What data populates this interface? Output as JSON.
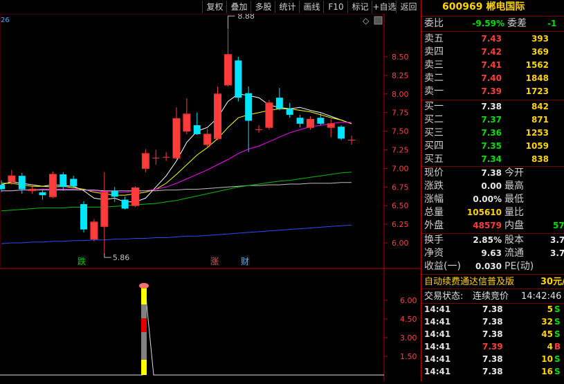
{
  "toolbar": {
    "buttons": [
      "复权",
      "叠加",
      "多股",
      "统计",
      "画线",
      "F10",
      "标记",
      "+自选",
      "返回"
    ]
  },
  "chart": {
    "corner_label": "26",
    "diamond": "◇",
    "price_axis": [
      "8.50",
      "8.25",
      "8.00",
      "7.75",
      "7.50",
      "7.25",
      "7.00",
      "6.75",
      "6.50",
      "6.25",
      "6.00"
    ],
    "high_label": "8.88",
    "low_label": "5.86",
    "markers": [
      {
        "text": "跌",
        "color": "#00c000"
      },
      {
        "text": "涨",
        "color": "#ff3c3c"
      },
      {
        "text": "财",
        "color": "#4fa8ff"
      }
    ],
    "sub_axis": [
      "6.00",
      "4.50",
      "3.00",
      "1.50"
    ]
  },
  "chart_data": {
    "type": "candlestick",
    "ylim": [
      5.75,
      9.0
    ],
    "candles": [
      {
        "o": 6.78,
        "c": 6.72,
        "h": 6.84,
        "l": 6.68
      },
      {
        "o": 6.82,
        "c": 6.9,
        "h": 6.98,
        "l": 6.78
      },
      {
        "o": 6.9,
        "c": 6.72,
        "h": 6.94,
        "l": 6.66
      },
      {
        "o": 6.7,
        "c": 6.72,
        "h": 6.76,
        "l": 6.66
      },
      {
        "o": 6.68,
        "c": 6.64,
        "h": 6.72,
        "l": 6.58
      },
      {
        "o": 6.62,
        "c": 6.92,
        "h": 6.96,
        "l": 6.6
      },
      {
        "o": 6.92,
        "c": 6.75,
        "h": 6.95,
        "l": 6.7
      },
      {
        "o": 6.86,
        "c": 6.76,
        "h": 6.9,
        "l": 6.74
      },
      {
        "o": 6.52,
        "c": 6.18,
        "h": 6.56,
        "l": 6.14
      },
      {
        "o": 6.05,
        "c": 6.28,
        "h": 6.32,
        "l": 6.02
      },
      {
        "o": 6.22,
        "c": 6.68,
        "h": 6.95,
        "l": 5.86
      },
      {
        "o": 6.7,
        "c": 6.62,
        "h": 6.75,
        "l": 6.55
      },
      {
        "o": 6.58,
        "c": 6.46,
        "h": 6.62,
        "l": 6.45
      },
      {
        "o": 6.5,
        "c": 6.74,
        "h": 6.76,
        "l": 6.48
      },
      {
        "o": 7.0,
        "c": 7.2,
        "h": 7.26,
        "l": 6.95
      },
      {
        "o": 7.14,
        "c": 7.14,
        "h": 7.25,
        "l": 7.05
      },
      {
        "o": 7.15,
        "c": 7.15,
        "h": 7.22,
        "l": 7.1
      },
      {
        "o": 7.14,
        "c": 7.67,
        "h": 7.82,
        "l": 7.12
      },
      {
        "o": 7.5,
        "c": 7.73,
        "h": 7.94,
        "l": 7.46
      },
      {
        "o": 7.58,
        "c": 7.46,
        "h": 7.75,
        "l": 7.45
      },
      {
        "o": 7.32,
        "c": 7.46,
        "h": 7.53,
        "l": 7.28
      },
      {
        "o": 7.4,
        "c": 8.0,
        "h": 8.1,
        "l": 7.38
      },
      {
        "o": 8.12,
        "c": 8.53,
        "h": 8.88,
        "l": 8.1
      },
      {
        "o": 8.45,
        "c": 7.95,
        "h": 8.5,
        "l": 7.9
      },
      {
        "o": 8.01,
        "c": 7.64,
        "h": 8.1,
        "l": 7.22
      },
      {
        "o": 7.52,
        "c": 7.52,
        "h": 7.58,
        "l": 7.48
      },
      {
        "o": 7.55,
        "c": 7.88,
        "h": 7.92,
        "l": 7.52
      },
      {
        "o": 7.95,
        "c": 7.8,
        "h": 8.08,
        "l": 7.78
      },
      {
        "o": 7.8,
        "c": 7.72,
        "h": 7.88,
        "l": 7.68
      },
      {
        "o": 7.68,
        "c": 7.6,
        "h": 7.72,
        "l": 7.55
      },
      {
        "o": 7.55,
        "c": 7.66,
        "h": 7.7,
        "l": 7.52
      },
      {
        "o": 7.68,
        "c": 7.6,
        "h": 7.74,
        "l": 7.58
      },
      {
        "o": 7.55,
        "c": 7.6,
        "h": 7.66,
        "l": 7.42
      },
      {
        "o": 7.56,
        "c": 7.4,
        "h": 7.58,
        "l": 7.38
      },
      {
        "o": 7.38,
        "c": 7.38,
        "h": 7.44,
        "l": 7.32
      }
    ],
    "ma": [
      {
        "color": "#ffffff",
        "values": [
          6.78,
          6.82,
          6.8,
          6.78,
          6.76,
          6.78,
          6.77,
          6.76,
          6.7,
          6.6,
          6.58,
          6.6,
          6.55,
          6.55,
          6.6,
          6.75,
          6.9,
          7.1,
          7.35,
          7.5,
          7.55,
          7.68,
          7.9,
          8.0,
          7.98,
          7.95,
          7.85,
          7.82,
          7.8,
          7.82,
          7.78,
          7.75,
          7.7,
          7.65,
          7.6
        ]
      },
      {
        "color": "#ffff00",
        "values": [
          6.8,
          6.8,
          6.78,
          6.76,
          6.76,
          6.75,
          6.76,
          6.74,
          6.72,
          6.68,
          6.66,
          6.64,
          6.64,
          6.66,
          6.68,
          6.72,
          6.8,
          6.92,
          7.05,
          7.18,
          7.28,
          7.4,
          7.55,
          7.68,
          7.72,
          7.75,
          7.78,
          7.8,
          7.8,
          7.78,
          7.76,
          7.72,
          7.68,
          7.65,
          7.6
        ]
      },
      {
        "color": "#ff00ff",
        "values": [
          6.7,
          6.7,
          6.71,
          6.71,
          6.72,
          6.72,
          6.72,
          6.72,
          6.71,
          6.7,
          6.69,
          6.68,
          6.68,
          6.69,
          6.7,
          6.72,
          6.75,
          6.8,
          6.86,
          6.92,
          6.98,
          7.05,
          7.12,
          7.2,
          7.26,
          7.3,
          7.36,
          7.42,
          7.48,
          7.52,
          7.56,
          7.58,
          7.6,
          7.62,
          7.62
        ]
      },
      {
        "color": "#c0c0c0",
        "values": [
          6.7,
          6.7,
          6.71,
          6.71,
          6.71,
          6.71,
          6.71,
          6.71,
          6.71,
          6.71,
          6.7,
          6.7,
          6.7,
          6.7,
          6.7,
          6.7,
          6.71,
          6.71,
          6.72,
          6.72,
          6.73,
          6.74,
          6.75,
          6.76,
          6.77,
          6.77,
          6.78,
          6.78,
          6.79,
          6.79,
          6.8,
          6.8,
          6.8,
          6.81,
          6.81
        ]
      },
      {
        "color": "#00c000",
        "values": [
          6.43,
          6.44,
          6.45,
          6.46,
          6.47,
          6.47,
          6.47,
          6.48,
          6.48,
          6.48,
          6.48,
          6.49,
          6.5,
          6.51,
          6.52,
          6.53,
          6.55,
          6.57,
          6.6,
          6.63,
          6.66,
          6.69,
          6.72,
          6.75,
          6.77,
          6.79,
          6.81,
          6.83,
          6.84,
          6.86,
          6.88,
          6.9,
          6.92,
          6.94,
          6.95
        ]
      },
      {
        "color": "#2a4cff",
        "values": [
          5.99,
          6.0,
          6.0,
          6.01,
          6.01,
          6.02,
          6.02,
          6.03,
          6.03,
          6.04,
          6.04,
          6.05,
          6.05,
          6.06,
          6.06,
          6.07,
          6.07,
          6.08,
          6.09,
          6.09,
          6.1,
          6.11,
          6.12,
          6.13,
          6.14,
          6.15,
          6.16,
          6.17,
          6.18,
          6.19,
          6.2,
          6.21,
          6.22,
          6.23,
          6.24
        ]
      }
    ],
    "sub": {
      "ylim": [
        0,
        7.0
      ],
      "spike_index": 13,
      "spike_value": 7.0
    }
  },
  "panel": {
    "title": "600969 郴电国际",
    "weibi_label": "委比",
    "weibi_value": "-9.59%",
    "weicha_label": "委差",
    "weicha_value": "-1",
    "sell": [
      {
        "label": "卖五",
        "price": "7.43",
        "vol": "393"
      },
      {
        "label": "卖四",
        "price": "7.42",
        "vol": "369"
      },
      {
        "label": "卖三",
        "price": "7.41",
        "vol": "1562"
      },
      {
        "label": "卖二",
        "price": "7.40",
        "vol": "1848"
      },
      {
        "label": "卖一",
        "price": "7.39",
        "vol": "1723"
      }
    ],
    "buy": [
      {
        "label": "买一",
        "price": "7.38",
        "vol": "842",
        "color": "white"
      },
      {
        "label": "买二",
        "price": "7.37",
        "vol": "871",
        "color": "green"
      },
      {
        "label": "买三",
        "price": "7.36",
        "vol": "1253",
        "color": "green"
      },
      {
        "label": "买四",
        "price": "7.35",
        "vol": "1059",
        "color": "green"
      },
      {
        "label": "买五",
        "price": "7.34",
        "vol": "838",
        "color": "green"
      }
    ],
    "stats": [
      {
        "l1": "现价",
        "v1": "7.38",
        "c1": "white",
        "l2": "今开",
        "v2": ""
      },
      {
        "l1": "涨跌",
        "v1": "0.00",
        "c1": "white",
        "l2": "最高",
        "v2": ""
      },
      {
        "l1": "涨幅",
        "v1": "0.00%",
        "c1": "white",
        "l2": "最低",
        "v2": ""
      },
      {
        "l1": "总量",
        "v1": "105610",
        "c1": "yellow",
        "l2": "量比",
        "v2": ""
      },
      {
        "l1": "外盘",
        "v1": "48579",
        "c1": "red",
        "l2": "内盘",
        "v2": "57"
      }
    ],
    "stats2": [
      {
        "l1": "换手",
        "v1": "2.85%",
        "l2": "股本",
        "v2": "3.7"
      },
      {
        "l1": "净资",
        "v1": "9.63",
        "l2": "流通",
        "v2": "3.7"
      },
      {
        "l1": "收益(一)",
        "v1": "0.030",
        "l2": "PE(动)",
        "v2": ""
      }
    ],
    "ad_text": "自动续费通达信普及版",
    "ad_price": "30元/",
    "status_label": "交易状态:",
    "status_value": "连续竞价",
    "status_time": "14:42:46",
    "trades": [
      {
        "time": "14:41",
        "price": "7.38",
        "vol": "5",
        "side": "S",
        "pc": "white",
        "sc": "green"
      },
      {
        "time": "14:41",
        "price": "7.38",
        "vol": "32",
        "side": "S",
        "pc": "white",
        "sc": "green"
      },
      {
        "time": "14:41",
        "price": "7.38",
        "vol": "45",
        "side": "S",
        "pc": "white",
        "sc": "green"
      },
      {
        "time": "14:41",
        "price": "7.39",
        "vol": "4",
        "side": "B",
        "pc": "red",
        "sc": "red"
      },
      {
        "time": "14:41",
        "price": "7.38",
        "vol": "10",
        "side": "S",
        "pc": "white",
        "sc": "green"
      },
      {
        "time": "14:41",
        "price": "7.38",
        "vol": "16",
        "side": "S",
        "pc": "white",
        "sc": "green"
      }
    ]
  }
}
